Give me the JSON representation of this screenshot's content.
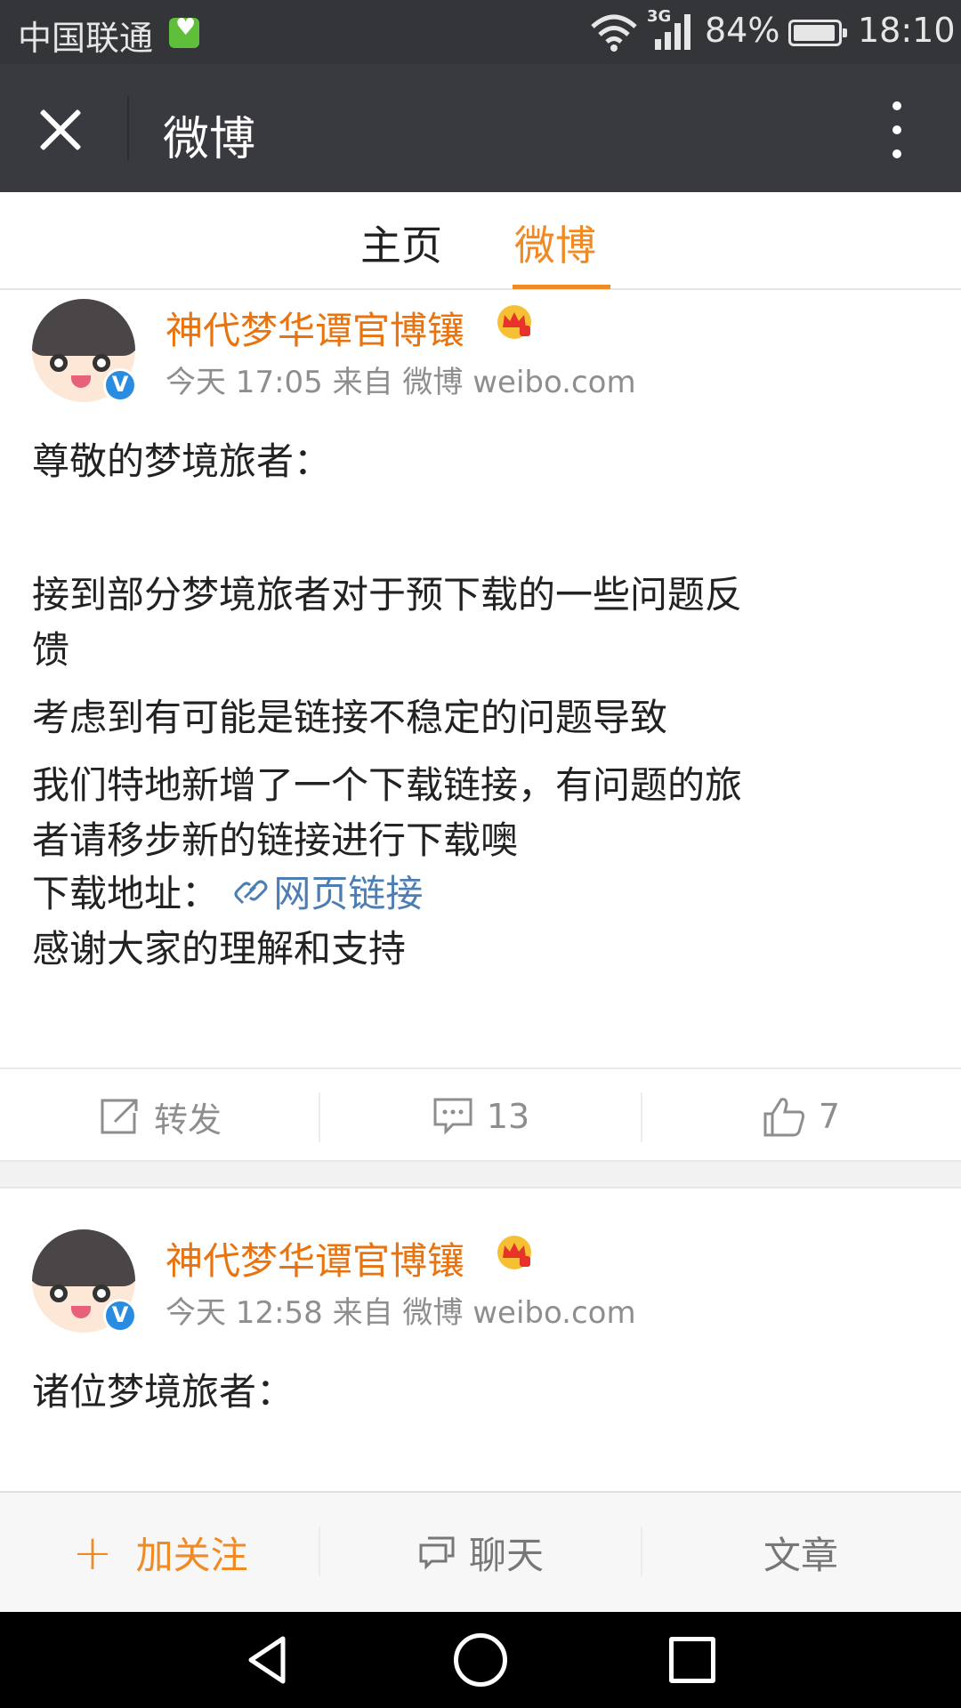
{
  "status_bar": {
    "carrier": "中国联通",
    "network": "3G",
    "battery": "84%",
    "time": "18:10"
  },
  "title_bar": {
    "title": "微博"
  },
  "tabs": [
    {
      "label": "主页",
      "active": false
    },
    {
      "label": "微博",
      "active": true
    }
  ],
  "accent_color": "#f08a24",
  "posts": [
    {
      "author": "神代梦华谭官博镶",
      "meta": "今天 17:05 来自 微博 weibo.com",
      "verified": true,
      "lines": [
        "尊敬的梦境旅者：",
        "",
        "接到部分梦境旅者对于预下载的一些问题反",
        "馈",
        "考虑到有可能是链接不稳定的问题导致",
        "我们特地新增了一个下载链接，有问题的旅",
        "者请移步新的链接进行下载噢"
      ],
      "download_label": "下载地址：",
      "link_text": "网页链接",
      "closing": "感谢大家的理解和支持",
      "repost_label": "转发",
      "comments": "13",
      "likes": "7"
    },
    {
      "author": "神代梦华谭官博镶",
      "meta": "今天 12:58 来自 微博 weibo.com",
      "verified": true,
      "lines": [
        "诸位梦境旅者："
      ]
    }
  ],
  "bottom_bar": {
    "follow": "加关注",
    "chat": "聊天",
    "article": "文章"
  }
}
